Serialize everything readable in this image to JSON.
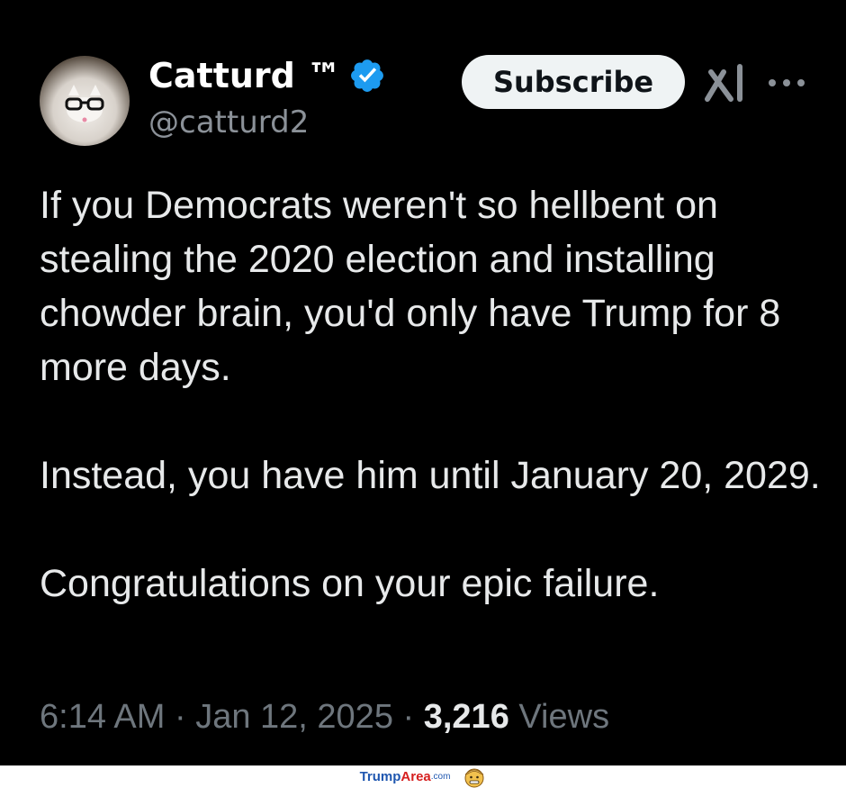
{
  "tweet": {
    "author": {
      "name": "Catturd ™",
      "handle": "@catturd2",
      "avatar_icon": "cat-with-glasses-avatar",
      "verified_icon": "verified-badge-icon",
      "verified_color": "#1d9bf0"
    },
    "actions": {
      "subscribe_label": "Subscribe",
      "grok_icon": "grok-icon",
      "more_icon": "more-options-icon"
    },
    "text": {
      "paragraph_1": "If you Democrats weren't so hellbent on stealing the 2020 election and installing chowder brain, you'd only have Trump for 8 more days.",
      "paragraph_2": "Instead, you have him until January 20, 2029.",
      "paragraph_3": "Congratulations on your epic failure."
    },
    "meta": {
      "time": "6:14 AM",
      "separator": "·",
      "date": "Jan 12, 2025",
      "views_count": "3,216",
      "views_label": "Views"
    }
  },
  "watermark": {
    "brand_part_1": "Trump",
    "brand_part_2": "Area",
    "brand_suffix": ".com",
    "mascot_icon": "trump-face-emoji-icon"
  },
  "colors": {
    "background": "#000000",
    "text_primary": "#e7e9ea",
    "text_secondary": "#6e767d",
    "verified": "#1d9bf0",
    "subscribe_bg": "#eff3f4"
  }
}
